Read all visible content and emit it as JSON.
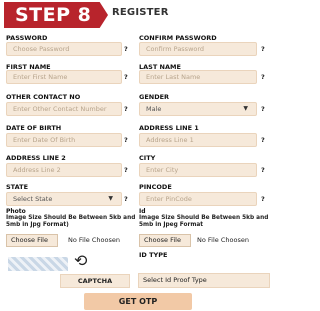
{
  "header": {
    "step": "STEP 8",
    "title": "REGISTER"
  },
  "fields": {
    "password": {
      "label": "PASSWORD",
      "placeholder": "Choose Password",
      "help": "?"
    },
    "confirm_password": {
      "label": "CONFIRM PASSWORD",
      "placeholder": "Confirm Password",
      "help": "?"
    },
    "first_name": {
      "label": "FIRST NAME",
      "placeholder": "Enter First Name",
      "help": "?"
    },
    "last_name": {
      "label": "LAST NAME",
      "placeholder": "Enter Last Name",
      "help": "?"
    },
    "other_contact": {
      "label": "OTHER CONTACT NO",
      "placeholder": "Enter Other Contact Number",
      "help": "?"
    },
    "gender": {
      "label": "GENDER",
      "value": "Male",
      "help": "?"
    },
    "dob": {
      "label": "DATE OF BIRTH",
      "placeholder": "Enter Date Of Birth",
      "help": "?"
    },
    "address1": {
      "label": "ADDRESS LINE 1",
      "placeholder": "Address Line 1",
      "help": "?"
    },
    "address2": {
      "label": "ADDRESS LINE 2",
      "placeholder": "Address Line 2",
      "help": "?"
    },
    "city": {
      "label": "CITY",
      "placeholder": "Enter City",
      "help": "?"
    },
    "state": {
      "label": "STATE",
      "value": "Select State",
      "help": "?"
    },
    "pincode": {
      "label": "PINCODE",
      "placeholder": "Enter PinCode",
      "help": "?"
    }
  },
  "photo": {
    "label": "Photo",
    "note": "Image Size Should Be Between 5kb and 5mb in Jpg Format)",
    "button": "Choose File",
    "status": "No File Choosen"
  },
  "id_upload": {
    "label": "Id",
    "note": "Image Size Should Be Between 5kb  and 5mb in Jpeg Format",
    "button": "Choose File",
    "status": "No File Choosen"
  },
  "id_type": {
    "label": "ID TYPE",
    "value": "Select Id Proof Type"
  },
  "captcha": {
    "label": "CAPTCHA",
    "refresh_icon": "refresh-icon"
  },
  "submit": {
    "label": "GET OTP"
  },
  "colors": {
    "ribbon": "#b8242c",
    "field_bg": "#f6e9da",
    "button_bg": "#f2c9a6"
  }
}
